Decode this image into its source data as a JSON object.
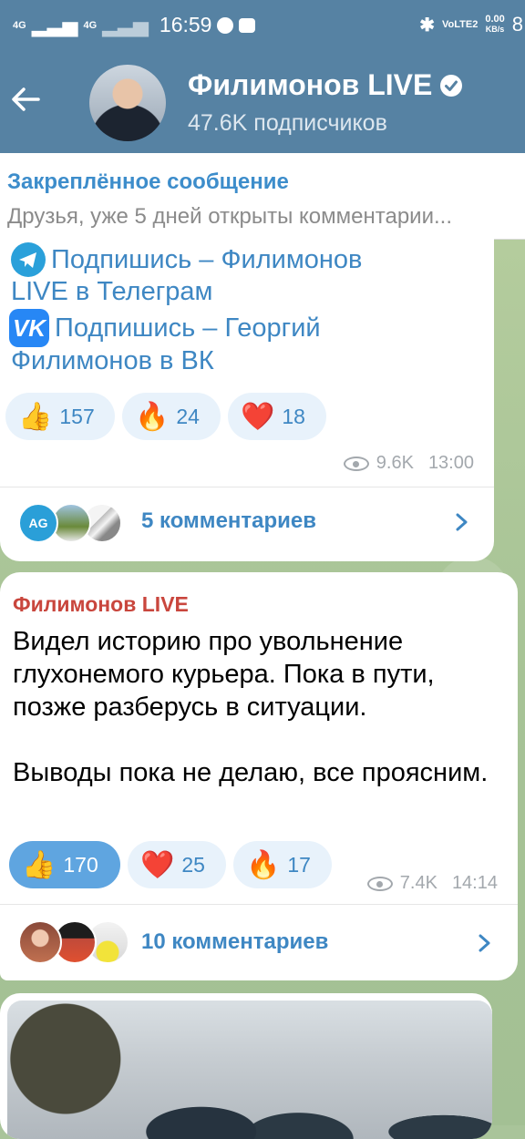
{
  "status_bar": {
    "network1": "4G",
    "network2": "4G",
    "time": "16:59",
    "volte": "VoLTE2",
    "speed": "0.00",
    "speed_unit": "KB/s",
    "battery_partial": "8"
  },
  "header": {
    "title": "Филимонов LIVE",
    "subtitle": "47.6K подписчиков"
  },
  "pinned": {
    "title": "Закреплённое сообщение",
    "text": "Друзья, уже 5 дней открыты комментарии..."
  },
  "post1": {
    "line1": "Подпишись – Филимонов",
    "line2": "LIVE в Телеграм",
    "line3": "Подпишись – Георгий",
    "line4": "Филимонов в ВК",
    "vk_label": "VK",
    "reactions": [
      {
        "emoji": "👍",
        "count": "157"
      },
      {
        "emoji": "🔥",
        "count": "24"
      },
      {
        "emoji": "❤️",
        "count": "18"
      }
    ],
    "views": "9.6K",
    "time": "13:00",
    "avatar_initials": "AG",
    "comments": "5 комментариев"
  },
  "post2": {
    "author": "Филимонов LIVE",
    "text": "Видел историю про увольнение глухонемого курьера. Пока в пути, позже разберусь в ситуации.\n\nВыводы пока не делаю, все проясним.",
    "reactions": [
      {
        "emoji": "👍",
        "count": "170"
      },
      {
        "emoji": "❤️",
        "count": "25"
      },
      {
        "emoji": "🔥",
        "count": "17"
      }
    ],
    "views": "7.4K",
    "time": "14:14",
    "comments": "10 комментариев"
  },
  "colors": {
    "header_bg": "#5682a3",
    "link": "#3e87c3",
    "author": "#c9463d",
    "reaction_active": "#5fa5e0"
  }
}
